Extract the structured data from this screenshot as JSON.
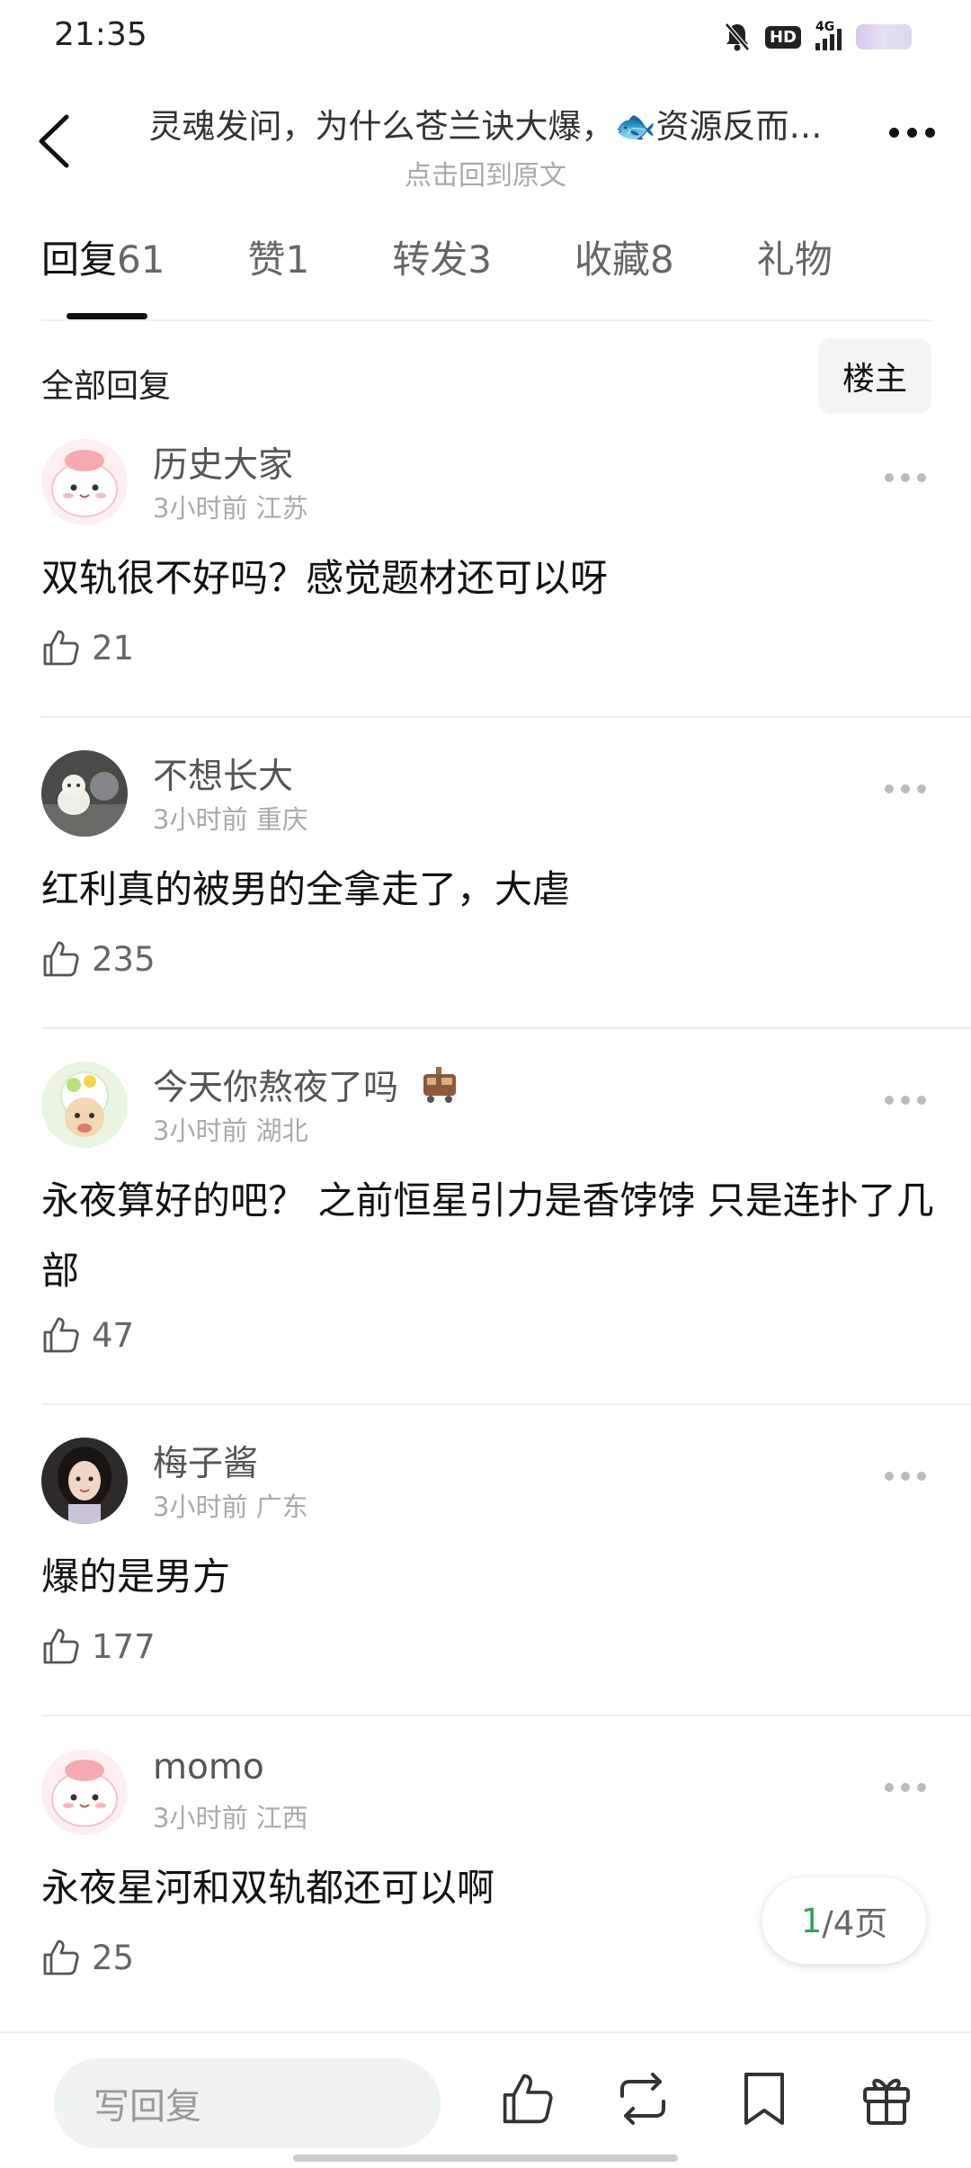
{
  "status_bar": {
    "time": "21:35",
    "hd": "HD",
    "network": "4G"
  },
  "header": {
    "title": "灵魂发问，为什么苍兰诀大爆，🐟资源反而…",
    "subtitle": "点击回到原文"
  },
  "tabs": [
    {
      "label": "回复",
      "count": "61",
      "active": true
    },
    {
      "label": "赞",
      "count": "1"
    },
    {
      "label": "转发",
      "count": "3"
    },
    {
      "label": "收藏",
      "count": "8"
    },
    {
      "label": "礼物",
      "count": ""
    }
  ],
  "section": {
    "title": "全部回复",
    "filter_label": "楼主"
  },
  "comments": [
    {
      "username": "历史大家",
      "time": "3小时前",
      "location": "江苏",
      "text": "双轨很不好吗？感觉题材还可以呀",
      "likes": "21"
    },
    {
      "username": "不想长大",
      "time": "3小时前",
      "location": "重庆",
      "text": "红利真的被男的全拿走了，大虐",
      "likes": "235"
    },
    {
      "username": "今天你熬夜了吗",
      "time": "3小时前",
      "location": "湖北",
      "text": "永夜算好的吧？ 之前恒星引力是香饽饽 只是连扑了几部",
      "likes": "47"
    },
    {
      "username": "梅子酱",
      "time": "3小时前",
      "location": "广东",
      "text": "爆的是男方",
      "likes": "177"
    },
    {
      "username": "momo",
      "time": "3小时前",
      "location": "江西",
      "text": "永夜星河和双轨都还可以啊",
      "likes": "25"
    }
  ],
  "pager": {
    "current": "1",
    "total_text": "/4页"
  },
  "bottom_bar": {
    "reply_placeholder": "写回复"
  },
  "colors": {
    "accent_green": "#35a15a",
    "input_bg": "#edf3ee"
  }
}
